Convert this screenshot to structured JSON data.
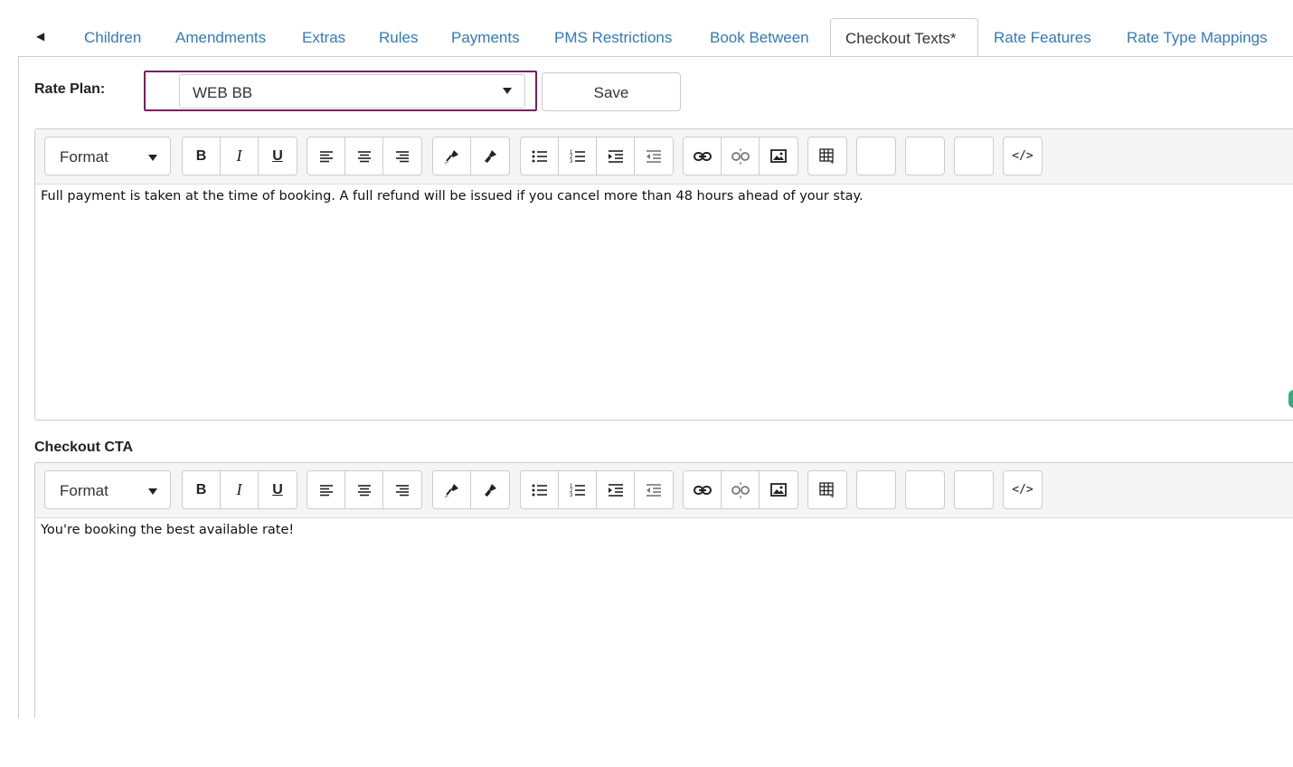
{
  "tabs": {
    "back_icon": "triangle-left-icon",
    "items": [
      {
        "label": "Children"
      },
      {
        "label": "Amendments"
      },
      {
        "label": "Extras"
      },
      {
        "label": "Rules"
      },
      {
        "label": "Payments"
      },
      {
        "label": "PMS Restrictions"
      },
      {
        "label": "Book Between"
      },
      {
        "label": "Checkout Texts*",
        "active": true
      },
      {
        "label": "Rate Features"
      },
      {
        "label": "Rate Type Mappings"
      }
    ]
  },
  "rate_plan": {
    "label": "Rate Plan:",
    "selected": "WEB BB",
    "save_label": "Save",
    "border_color": "#7a1f5e"
  },
  "editor1": {
    "format_label": "Format",
    "content": "Full payment is taken at the time of booking. A full refund will be issued if you cancel more than 48 hours ahead of your stay."
  },
  "editor2": {
    "section_label": "Checkout CTA",
    "format_label": "Format",
    "content": "You're booking the best available rate!"
  },
  "toolbar_icons": [
    "bold-icon",
    "italic-icon",
    "underline-icon",
    "align-left-icon",
    "align-center-icon",
    "align-right-icon",
    "paint-format-icon",
    "clear-format-icon",
    "bullet-list-icon",
    "numbered-list-icon",
    "indent-icon",
    "outdent-icon",
    "link-icon",
    "unlink-icon",
    "image-icon",
    "table-icon",
    "code-view-icon"
  ],
  "colors": {
    "link": "#337ab7",
    "accent": "#7a1f5e",
    "status_dot": "#2ab27b"
  }
}
